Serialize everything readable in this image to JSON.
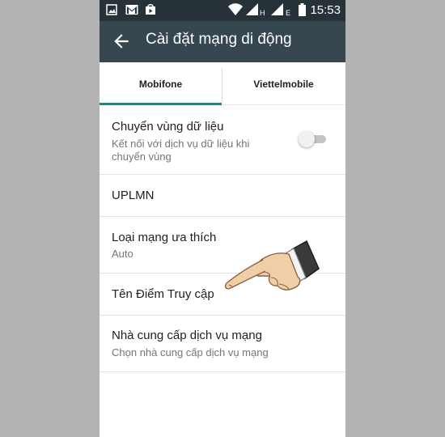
{
  "status_bar": {
    "time": "15:53",
    "network_label_1": "H",
    "network_label_2": "E",
    "icons": [
      "image-icon",
      "gmail-icon",
      "store-icon",
      "wifi-icon",
      "signal-icon",
      "signal-icon",
      "battery-icon"
    ]
  },
  "app_bar": {
    "title": "Cài đặt mạng di động",
    "back_icon": "arrow-left-icon"
  },
  "tabs": [
    {
      "label": "Mobifone",
      "selected": true
    },
    {
      "label": "Viettelmobile",
      "selected": false
    }
  ],
  "settings": {
    "roaming": {
      "title": "Chuyển vùng dữ liệu",
      "subtitle": "Kết nối với dịch vụ dữ liệu khi chuyển vùng",
      "enabled": false
    },
    "uplmn": {
      "title": "UPLMN"
    },
    "preferred_network": {
      "title": "Loại mạng ưa thích",
      "value": "Auto"
    },
    "apn": {
      "title": "Tên Điểm Truy cập"
    },
    "provider": {
      "title": "Nhà cung cấp dịch vụ mạng",
      "subtitle": "Chọn nhà cung cấp dịch vụ mạng"
    }
  },
  "overlay": {
    "icon": "pointing-hand-icon"
  },
  "colors": {
    "status_bar": "#263238",
    "app_bar": "#37474f",
    "accent": "#1b8a7a",
    "background": "#b3b3b3"
  }
}
